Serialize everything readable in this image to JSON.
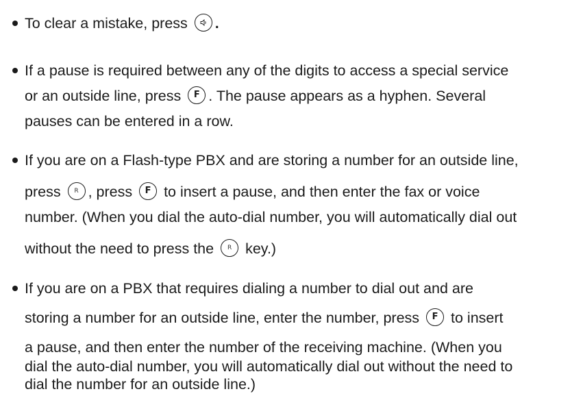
{
  "items": [
    {
      "line1_a": "To clear a mistake, press",
      "line1_key": "speaker-icon",
      "line1_b": "."
    },
    {
      "line1": "If a pause is required between any of the digits to access a special service",
      "line2_a": "or an outside line, press",
      "line2_key": "F",
      "line2_b": ". The pause appears as a hyphen. Several",
      "line3": "pauses can be entered in a row."
    },
    {
      "line1": "If you are on a Flash-type PBX and are storing a number for an outside line,",
      "line2_a": "press",
      "line2_key1": "R",
      "line2_b": ", press",
      "line2_key2": "F",
      "line2_c": "to insert a pause, and then enter the fax or voice",
      "line3": "number. (When you dial the auto-dial number, you will automatically dial out",
      "line4_a": "without the need to press the",
      "line4_key": "R",
      "line4_b": "key.)"
    },
    {
      "line1": "If you are on a PBX that requires dialing a number to dial out and are",
      "line2_a": "storing a number for an outside line, enter the number, press",
      "line2_key": "F",
      "line2_b": "to insert",
      "line3": "a pause, and then enter the number of the receiving machine. (When you",
      "line4": "dial the auto-dial number, you will automatically dial out without the need to",
      "line5": "dial the number for an outside line.)"
    }
  ]
}
